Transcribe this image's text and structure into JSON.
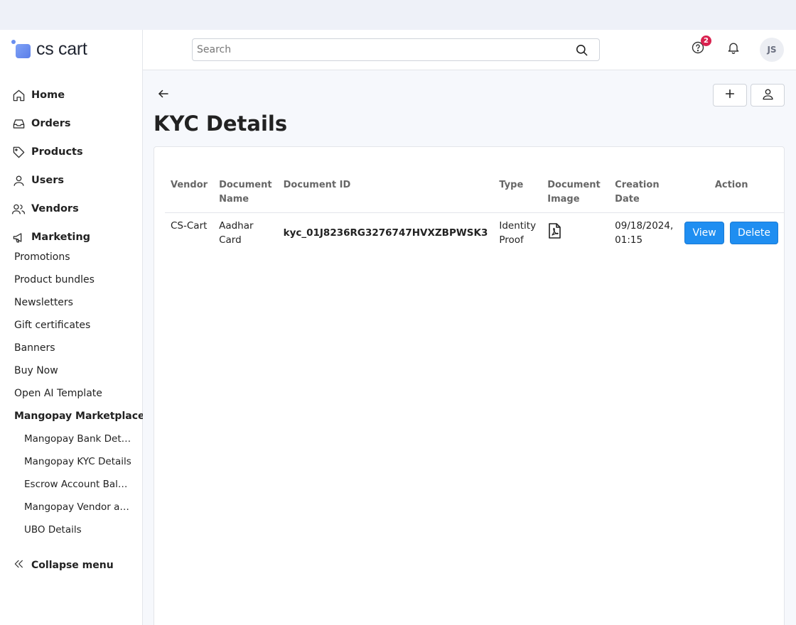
{
  "brand": {
    "logo_text": "cs cart"
  },
  "sidebar": {
    "main_items": [
      {
        "label": "Home",
        "icon": "home-icon"
      },
      {
        "label": "Orders",
        "icon": "inbox-icon"
      },
      {
        "label": "Products",
        "icon": "tag-icon"
      },
      {
        "label": "Users",
        "icon": "user-icon"
      },
      {
        "label": "Vendors",
        "icon": "users-icon"
      },
      {
        "label": "Marketing",
        "icon": "megaphone-icon"
      }
    ],
    "sub_items": [
      "Promotions",
      "Product bundles",
      "Newsletters",
      "Gift certificates",
      "Banners",
      "Buy Now",
      "Open AI Template"
    ],
    "group_label": "Mangopay Marketplace",
    "group_items": [
      "Mangopay Bank Details",
      "Mangopay KYC Details",
      "Escrow Account Balance",
      "Mangopay Vendor acco…",
      "UBO Details"
    ],
    "collapse_label": "Collapse menu"
  },
  "header": {
    "search_placeholder": "Search",
    "help_badge": "2",
    "avatar_initials": "JS"
  },
  "page": {
    "title": "KYC Details"
  },
  "table": {
    "columns": [
      "Vendor",
      "Document Name",
      "Document ID",
      "Type",
      "Document Image",
      "Creation Date",
      "Action"
    ],
    "rows": [
      {
        "vendor": "CS-Cart",
        "document_name": "Aadhar Card",
        "document_id": "kyc_01J8236RG3276747HVXZBPWSK3",
        "type": "Identity Proof",
        "document_image_icon": "pdf-file-icon",
        "creation_date": "09/18/2024, 01:15",
        "view_label": "View",
        "delete_label": "Delete"
      }
    ]
  },
  "colors": {
    "primary_button": "#1f8ef1",
    "badge": "#d9224f",
    "top_strip": "#eef1f8"
  }
}
